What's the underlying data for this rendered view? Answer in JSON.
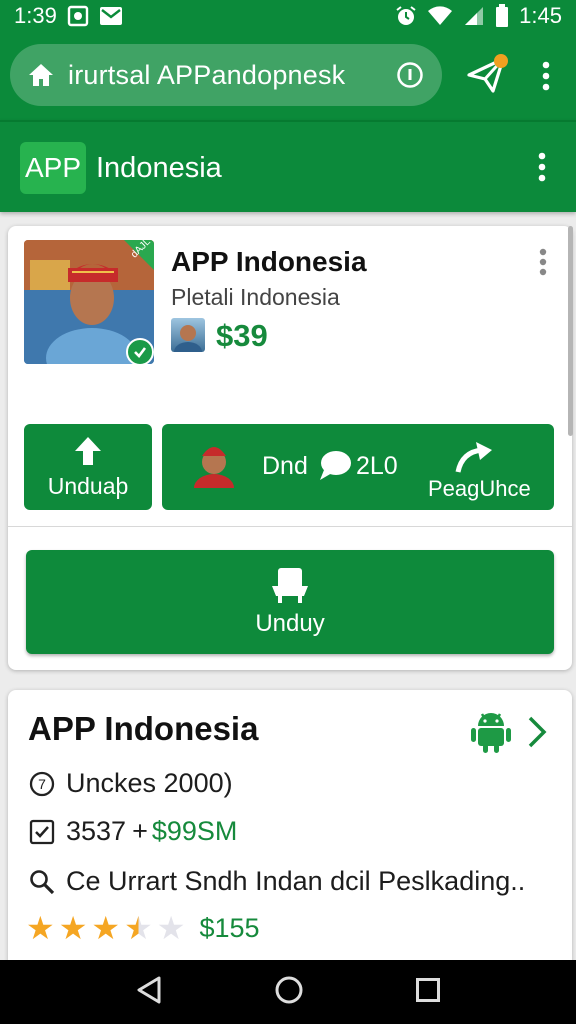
{
  "status_bar": {
    "time": "1:39",
    "clock": "1:45"
  },
  "browser": {
    "url": "irurtsal APPandopnesk",
    "send_badge_count": ""
  },
  "app_bar": {
    "logo_text": "APP",
    "title": "Indonesia"
  },
  "app_card": {
    "title": "APP Indonesia",
    "subtitle": "Pletali Indonesia",
    "price": "$39",
    "thumb_corner_text": "dAJL",
    "buttons": {
      "upload_label": "Unduaþ",
      "wide_text1": "Dnd",
      "wide_text2": "2L0",
      "wide_text3": "PeagUhce",
      "download_label": "Unduy"
    }
  },
  "details_card": {
    "title": "APP Indonesia",
    "row1": "Unckes 2000)",
    "row2_count": "3537",
    "row2_plus": "+",
    "row2_price": "$99SM",
    "row3": "Ce Urrart Sndh Indan dcil Peslkading..",
    "rating": 3.5,
    "rating_max": 5,
    "rating_price": "$155"
  },
  "colors": {
    "primary_green": "#0b8a3a",
    "accent_green": "#168a3c",
    "star": "#f5a623",
    "badge_orange": "#f0a020"
  },
  "icons": {
    "status": [
      "gallery-icon",
      "message-icon",
      "alarm-icon",
      "wifi-icon",
      "signal-icon",
      "battery-icon"
    ],
    "nav": [
      "back-icon",
      "home-icon",
      "recents-icon"
    ]
  }
}
